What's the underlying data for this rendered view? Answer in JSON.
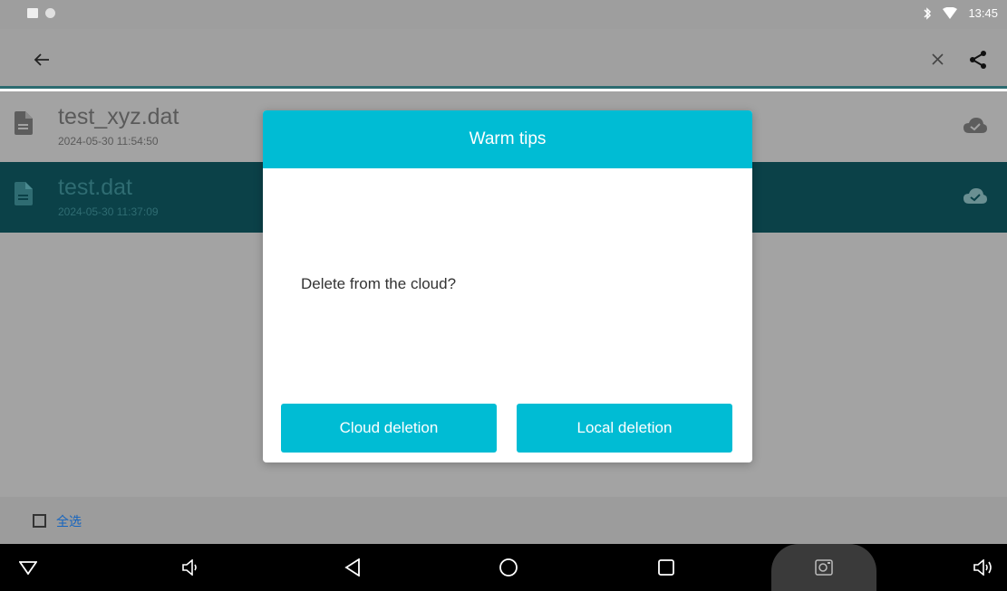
{
  "status_bar": {
    "time": "13:45",
    "icons": [
      "image-notification-icon",
      "circle-notification-icon",
      "bluetooth-icon",
      "wifi-icon"
    ]
  },
  "app_bar": {
    "icons": [
      "back-arrow-icon",
      "close-icon",
      "share-icon"
    ]
  },
  "files": [
    {
      "name": "test_xyz.dat",
      "date": "2024-05-30 11:54:50",
      "selected": false,
      "icon": "cloud-done-icon"
    },
    {
      "name": "test.dat",
      "date": "2024-05-30 11:37:09",
      "selected": true,
      "icon": "cloud-done-icon"
    }
  ],
  "select_bar": {
    "select_all_label": "全选"
  },
  "dialog": {
    "title": "Warm tips",
    "message": "Delete from the cloud?",
    "cloud_button": "Cloud deletion",
    "local_button": "Local deletion"
  },
  "nav_bar": {
    "icons": [
      "hide-nav-icon",
      "volume-down-icon",
      "back-icon",
      "home-icon",
      "recents-icon",
      "screenshot-icon",
      "volume-up-icon"
    ]
  },
  "colors": {
    "accent": "#00bcd4",
    "selected_row": "#0b4148",
    "scrim_gray": "#a3a3a3"
  }
}
